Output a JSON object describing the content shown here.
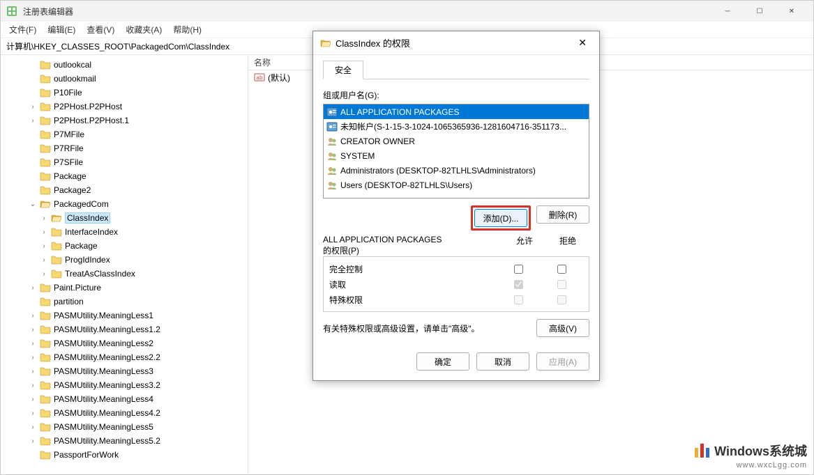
{
  "app": {
    "title": "注册表编辑器"
  },
  "menus": [
    "文件(F)",
    "编辑(E)",
    "查看(V)",
    "收藏夹(A)",
    "帮助(H)"
  ],
  "address": "计算机\\HKEY_CLASSES_ROOT\\PackagedCom\\ClassIndex",
  "tree": [
    {
      "label": "outlookcal",
      "depth": 2,
      "exp": ""
    },
    {
      "label": "outlookmail",
      "depth": 2,
      "exp": ""
    },
    {
      "label": "P10File",
      "depth": 2,
      "exp": ""
    },
    {
      "label": "P2PHost.P2PHost",
      "depth": 2,
      "exp": "›"
    },
    {
      "label": "P2PHost.P2PHost.1",
      "depth": 2,
      "exp": "›"
    },
    {
      "label": "P7MFile",
      "depth": 2,
      "exp": ""
    },
    {
      "label": "P7RFile",
      "depth": 2,
      "exp": ""
    },
    {
      "label": "P7SFile",
      "depth": 2,
      "exp": ""
    },
    {
      "label": "Package",
      "depth": 2,
      "exp": ""
    },
    {
      "label": "Package2",
      "depth": 2,
      "exp": ""
    },
    {
      "label": "PackagedCom",
      "depth": 2,
      "exp": "⌄",
      "open": true
    },
    {
      "label": "ClassIndex",
      "depth": 3,
      "exp": "›",
      "selected": true
    },
    {
      "label": "InterfaceIndex",
      "depth": 3,
      "exp": "›"
    },
    {
      "label": "Package",
      "depth": 3,
      "exp": "›"
    },
    {
      "label": "ProgIdIndex",
      "depth": 3,
      "exp": "›"
    },
    {
      "label": "TreatAsClassIndex",
      "depth": 3,
      "exp": "›"
    },
    {
      "label": "Paint.Picture",
      "depth": 2,
      "exp": "›"
    },
    {
      "label": "partition",
      "depth": 2,
      "exp": ""
    },
    {
      "label": "PASMUtility.MeaningLess1",
      "depth": 2,
      "exp": "›"
    },
    {
      "label": "PASMUtility.MeaningLess1.2",
      "depth": 2,
      "exp": "›"
    },
    {
      "label": "PASMUtility.MeaningLess2",
      "depth": 2,
      "exp": "›"
    },
    {
      "label": "PASMUtility.MeaningLess2.2",
      "depth": 2,
      "exp": "›"
    },
    {
      "label": "PASMUtility.MeaningLess3",
      "depth": 2,
      "exp": "›"
    },
    {
      "label": "PASMUtility.MeaningLess3.2",
      "depth": 2,
      "exp": "›"
    },
    {
      "label": "PASMUtility.MeaningLess4",
      "depth": 2,
      "exp": "›"
    },
    {
      "label": "PASMUtility.MeaningLess4.2",
      "depth": 2,
      "exp": "›"
    },
    {
      "label": "PASMUtility.MeaningLess5",
      "depth": 2,
      "exp": "›"
    },
    {
      "label": "PASMUtility.MeaningLess5.2",
      "depth": 2,
      "exp": "›"
    },
    {
      "label": "PassportForWork",
      "depth": 2,
      "exp": ""
    }
  ],
  "list": {
    "header": "名称",
    "rows": [
      {
        "name": "(默认)"
      }
    ]
  },
  "dialog": {
    "title": "ClassIndex 的权限",
    "tab": "安全",
    "groups_label": "组或用户名(G):",
    "users": [
      {
        "name": "ALL APPLICATION PACKAGES",
        "selected": true,
        "icon": "badge"
      },
      {
        "name": "未知帐户(S-1-15-3-1024-1065365936-1281604716-351173...",
        "icon": "badge"
      },
      {
        "name": "CREATOR OWNER",
        "icon": "group"
      },
      {
        "name": "SYSTEM",
        "icon": "group"
      },
      {
        "name": "Administrators (DESKTOP-82TLHLS\\Administrators)",
        "icon": "group"
      },
      {
        "name": "Users (DESKTOP-82TLHLS\\Users)",
        "icon": "group"
      }
    ],
    "add_btn": "添加(D)...",
    "remove_btn": "删除(R)",
    "perm_for_label_1": "ALL APPLICATION PACKAGES",
    "perm_for_label_2": "的权限(P)",
    "col_allow": "允许",
    "col_deny": "拒绝",
    "perms": [
      {
        "name": "完全控制",
        "allow": false,
        "deny": false,
        "disabled": false
      },
      {
        "name": "读取",
        "allow": true,
        "deny": false,
        "disabled": true
      },
      {
        "name": "特殊权限",
        "allow": false,
        "deny": false,
        "disabled": true
      }
    ],
    "hint": "有关特殊权限或高级设置，请单击\"高级\"。",
    "advanced_btn": "高级(V)",
    "ok": "确定",
    "cancel": "取消",
    "apply": "应用(A)"
  },
  "watermark": {
    "line1": "Windows系统城",
    "line2": "www.wxcLgg.com"
  }
}
